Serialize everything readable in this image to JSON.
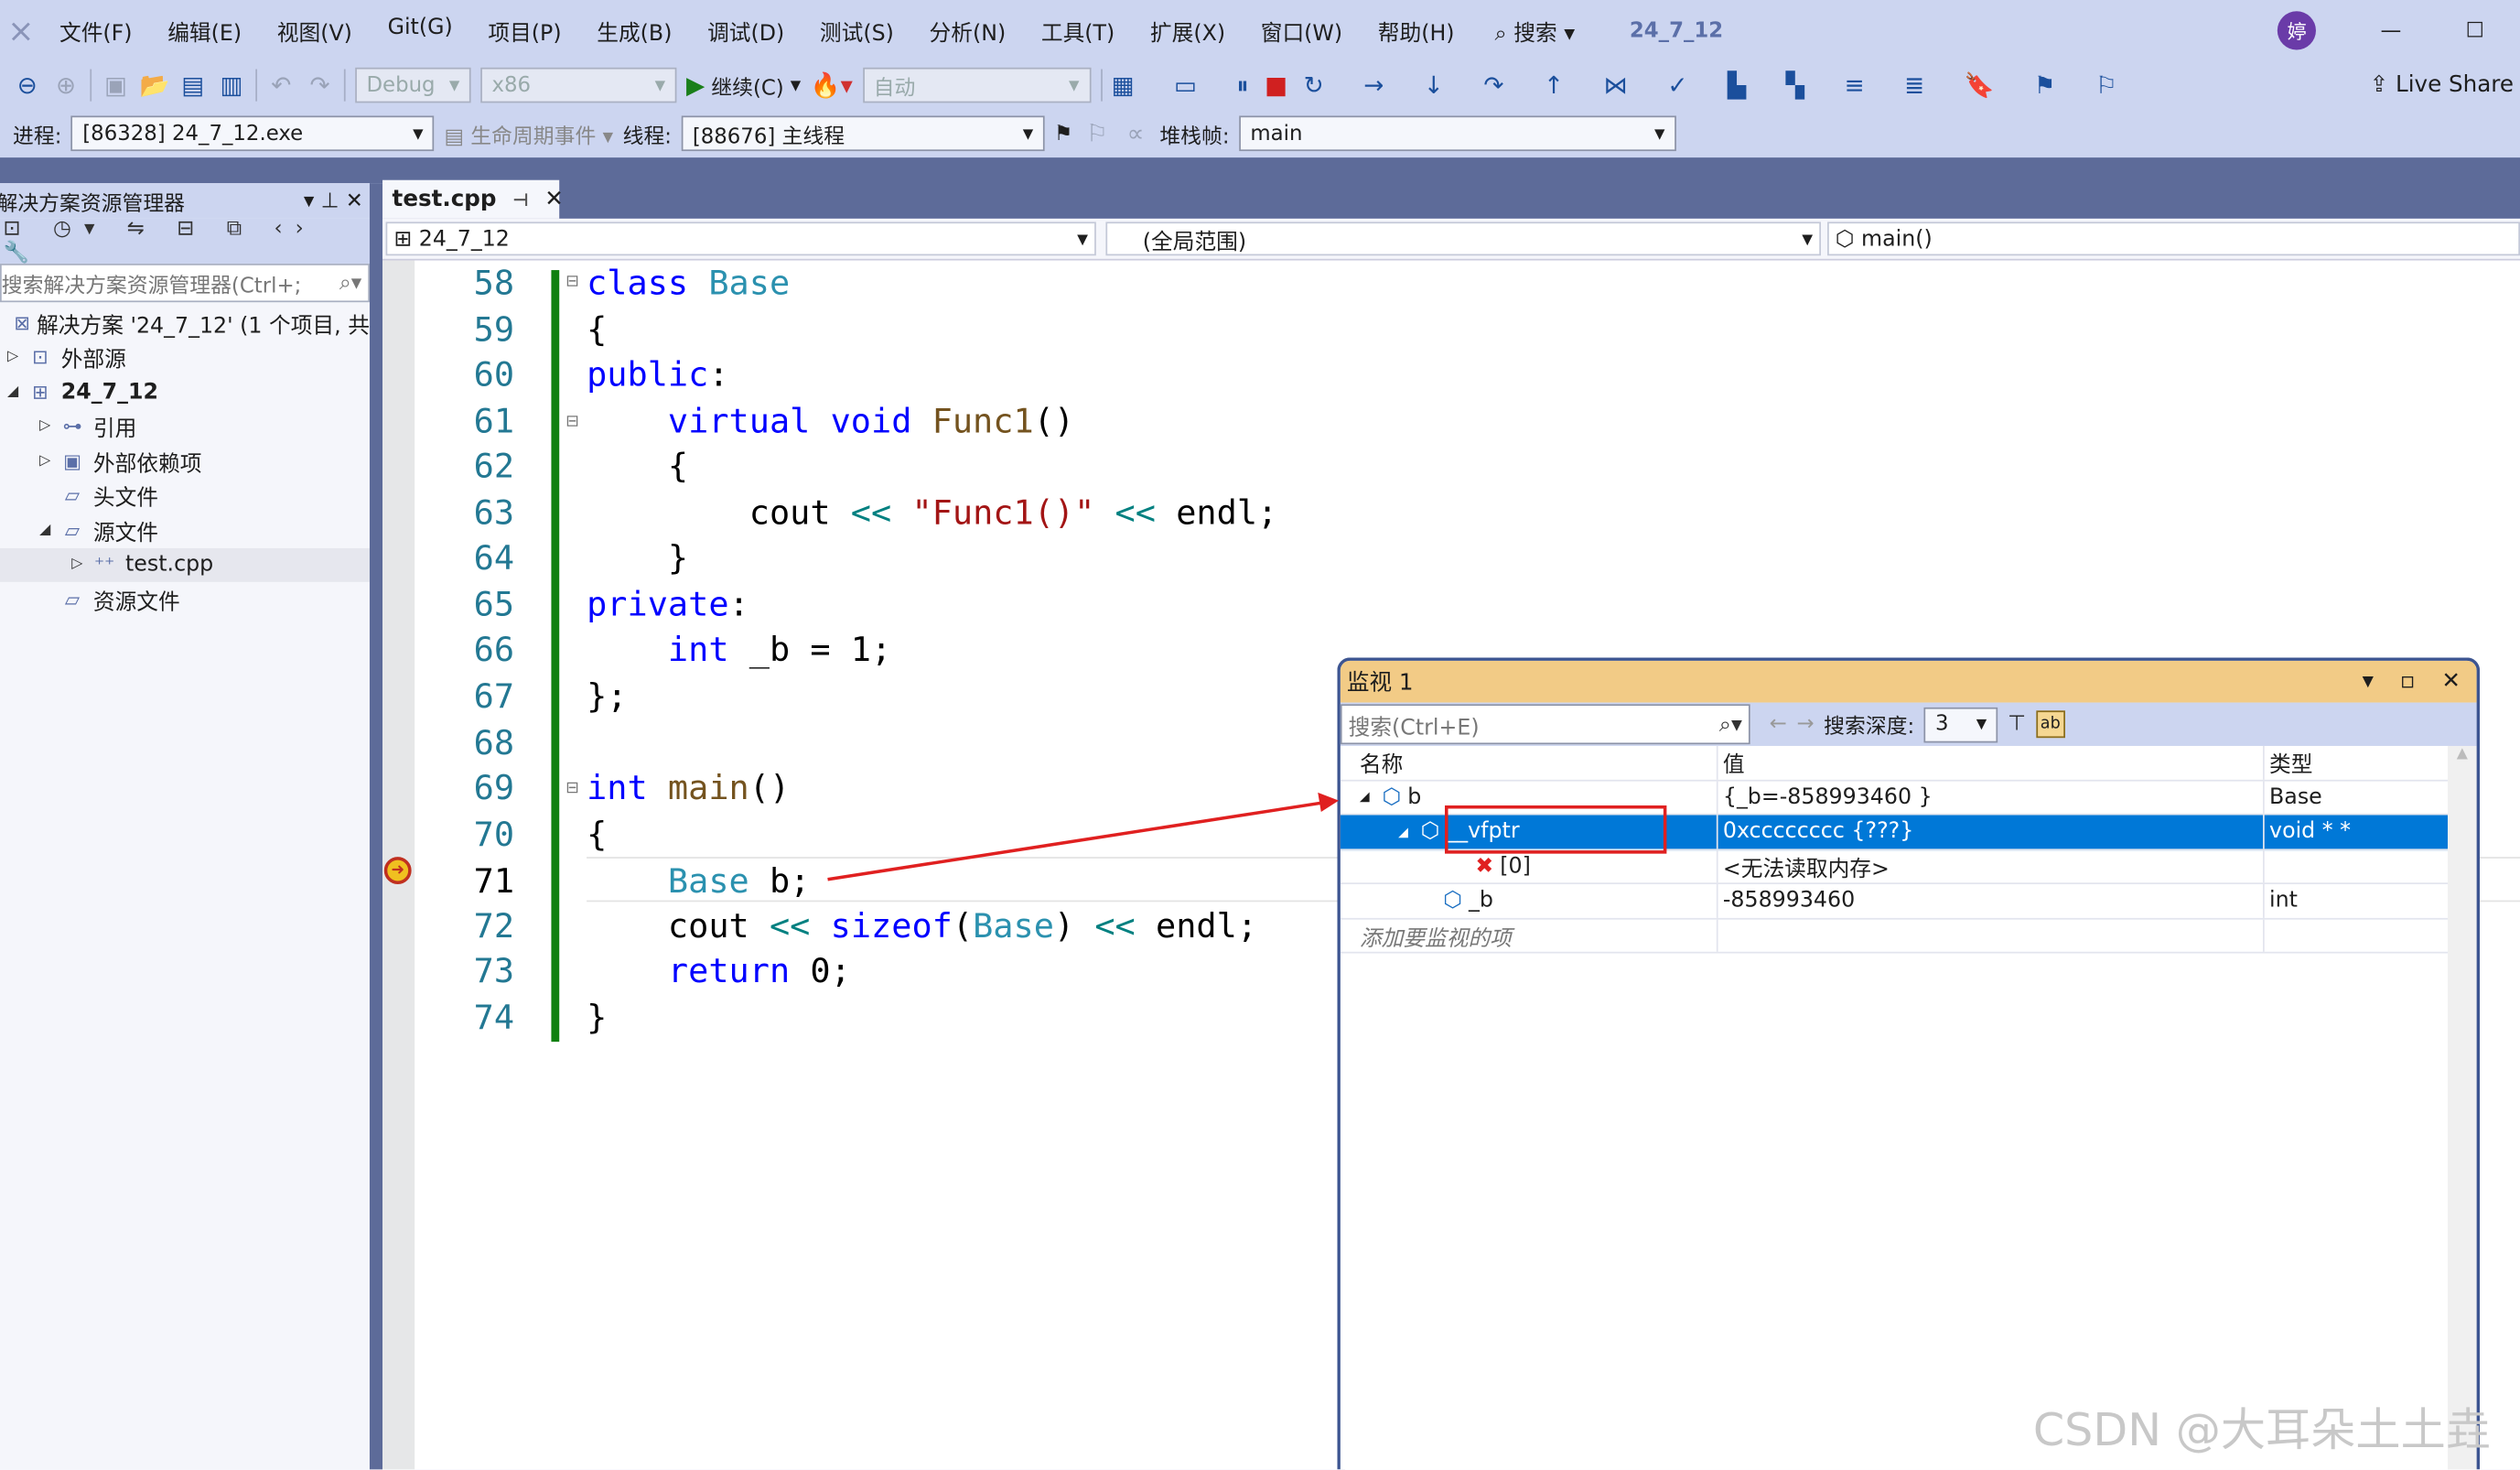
{
  "menubar": {
    "items": [
      "文件(F)",
      "编辑(E)",
      "视图(V)",
      "Git(G)",
      "项目(P)",
      "生成(B)",
      "调试(D)",
      "测试(S)",
      "分析(N)",
      "工具(T)",
      "扩展(X)",
      "窗口(W)",
      "帮助(H)"
    ],
    "search": "搜索",
    "solution_name": "24_7_12",
    "avatar": "婷"
  },
  "toolbar": {
    "config": "Debug",
    "platform": "x86",
    "continue": "继续(C)",
    "auto": "自动",
    "live_share": "Live Share"
  },
  "debug_location": {
    "process_label": "进程:",
    "process": "[86328] 24_7_12.exe",
    "lifecycle": "生命周期事件",
    "thread_label": "线程:",
    "thread": "[88676] 主线程",
    "stack_label": "堆栈帧:",
    "stack": "main"
  },
  "solution_explorer": {
    "title": "解决方案资源管理器",
    "search_placeholder": "搜索解决方案资源管理器(Ctrl+;",
    "items": [
      {
        "label": "解决方案 '24_7_12' (1 个项目, 共"
      },
      {
        "label": "外部源"
      },
      {
        "label": "24_7_12"
      },
      {
        "label": "引用"
      },
      {
        "label": "外部依赖项"
      },
      {
        "label": "头文件"
      },
      {
        "label": "源文件"
      },
      {
        "label": "test.cpp"
      },
      {
        "label": "资源文件"
      }
    ]
  },
  "editor": {
    "tab": "test.cpp",
    "nav_project": "24_7_12",
    "nav_scope": "(全局范围)",
    "nav_member": "main()",
    "current_line": 71,
    "lines": [
      {
        "n": "58",
        "t": [
          [
            "kw",
            "class "
          ],
          [
            "ty",
            "Base"
          ]
        ]
      },
      {
        "n": "59",
        "t": [
          [
            "pl",
            "{"
          ]
        ]
      },
      {
        "n": "60",
        "t": [
          [
            "kw",
            "public"
          ],
          [
            "pl",
            ":"
          ]
        ]
      },
      {
        "n": "61",
        "t": [
          [
            "pl",
            "    "
          ],
          [
            "kw",
            "virtual void "
          ],
          [
            "fn",
            "Func1"
          ],
          [
            "pl",
            "()"
          ]
        ]
      },
      {
        "n": "62",
        "t": [
          [
            "pl",
            "    {"
          ]
        ]
      },
      {
        "n": "63",
        "t": [
          [
            "pl",
            "        cout "
          ],
          [
            "op",
            "<<"
          ],
          [
            "pl",
            " "
          ],
          [
            "str",
            "\"Func1()\""
          ],
          [
            "pl",
            " "
          ],
          [
            "op",
            "<<"
          ],
          [
            "pl",
            " endl;"
          ]
        ]
      },
      {
        "n": "64",
        "t": [
          [
            "pl",
            "    }"
          ]
        ]
      },
      {
        "n": "65",
        "t": [
          [
            "kw",
            "private"
          ],
          [
            "pl",
            ":"
          ]
        ]
      },
      {
        "n": "66",
        "t": [
          [
            "pl",
            "    "
          ],
          [
            "kw",
            "int"
          ],
          [
            "pl",
            " _b = 1;"
          ]
        ]
      },
      {
        "n": "67",
        "t": [
          [
            "pl",
            "};"
          ]
        ]
      },
      {
        "n": "68",
        "t": []
      },
      {
        "n": "69",
        "t": [
          [
            "kw",
            "int "
          ],
          [
            "fn",
            "main"
          ],
          [
            "pl",
            "()"
          ]
        ]
      },
      {
        "n": "70",
        "t": [
          [
            "pl",
            "{"
          ]
        ]
      },
      {
        "n": "71",
        "t": [
          [
            "pl",
            "    "
          ],
          [
            "ty",
            "Base"
          ],
          [
            "pl",
            " b;"
          ]
        ]
      },
      {
        "n": "72",
        "t": [
          [
            "pl",
            "    cout "
          ],
          [
            "op",
            "<<"
          ],
          [
            "pl",
            " "
          ],
          [
            "kw",
            "sizeof"
          ],
          [
            "pl",
            "("
          ],
          [
            "ty",
            "Base"
          ],
          [
            "pl",
            ") "
          ],
          [
            "op",
            "<<"
          ],
          [
            "pl",
            " endl;"
          ]
        ]
      },
      {
        "n": "73",
        "t": [
          [
            "pl",
            "    "
          ],
          [
            "kw",
            "return"
          ],
          [
            "pl",
            " 0;"
          ]
        ]
      },
      {
        "n": "74",
        "t": [
          [
            "pl",
            "}"
          ]
        ]
      }
    ]
  },
  "watch": {
    "title": "监视 1",
    "search_placeholder": "搜索(Ctrl+E)",
    "depth_label": "搜索深度:",
    "depth": "3",
    "columns": [
      "名称",
      "值",
      "类型"
    ],
    "rows": [
      {
        "name": "b",
        "value": "{_b=-858993460 }",
        "type": "Base"
      },
      {
        "name": "__vfptr",
        "value": "0xcccccccc {???}",
        "type": "void * *"
      },
      {
        "name": "[0]",
        "value": "<无法读取内存>",
        "type": ""
      },
      {
        "name": "_b",
        "value": "-858993460",
        "type": "int"
      }
    ],
    "add_item": "添加要监视的项"
  },
  "watermark": "CSDN @大耳朵土土垚",
  "colors": {
    "annotation": "#e02020",
    "selection": "#0078d7",
    "watch_title": "#f2cb86"
  }
}
